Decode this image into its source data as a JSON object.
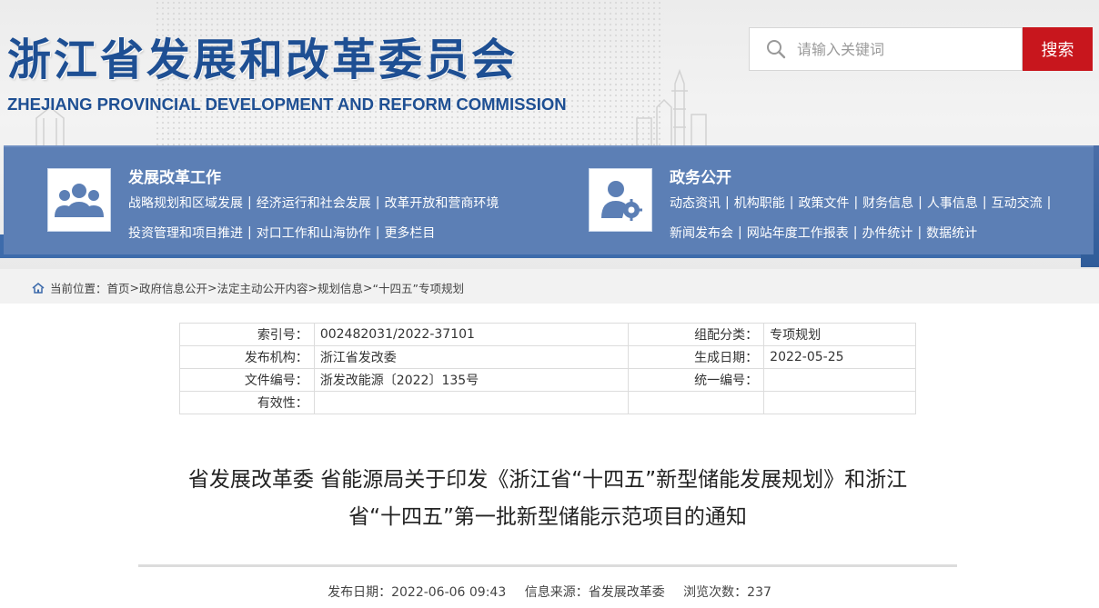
{
  "header": {
    "title_cn": "浙江省发展和改革委员会",
    "title_en": "ZHEJIANG PROVINCIAL DEVELOPMENT AND REFORM COMMISSION"
  },
  "search": {
    "placeholder": "请输入关键词",
    "button_label": "搜索"
  },
  "nav": {
    "left": {
      "heading": "发展改革工作",
      "icon": "people-group-icon",
      "row1": [
        "战略规划和区域发展",
        "经济运行和社会发展",
        "改革开放和营商环境"
      ],
      "row2": [
        "投资管理和项目推进",
        "对口工作和山海协作",
        "更多栏目"
      ]
    },
    "right": {
      "heading": "政务公开",
      "icon": "user-gear-icon",
      "row1": [
        "动态资讯",
        "机构职能",
        "政策文件",
        "财务信息",
        "人事信息",
        "互动交流"
      ],
      "row2": [
        "新闻发布会",
        "网站年度工作报表",
        "办件统计",
        "数据统计"
      ]
    },
    "separator": "|",
    "row1_trailing_sep": "|"
  },
  "breadcrumb": {
    "prefix": "当前位置：",
    "items": [
      "首页",
      "政府信息公开",
      "法定主动公开内容",
      "规划信息",
      "“十四五”专项规划"
    ],
    "separator": ">"
  },
  "meta": {
    "index_label": "索引号：",
    "index_value": "002482031/2022-37101",
    "category_label": "组配分类：",
    "category_value": "专项规划",
    "publisher_label": "发布机构：",
    "publisher_value": "浙江省发改委",
    "date_label": "生成日期：",
    "date_value": "2022-05-25",
    "docno_label": "文件编号：",
    "docno_value": "浙发改能源〔2022〕135号",
    "unified_label": "统一编号：",
    "unified_value": "",
    "validity_label": "有效性：",
    "validity_value": ""
  },
  "article": {
    "title_line1": "省发展改革委 省能源局关于印发《浙江省“十四五”新型储能发展规划》和浙江",
    "title_line2": "省“十四五”第一批新型储能示范项目的通知",
    "publish_date": "发布日期：2022-06-06 09:43",
    "source": "信息来源：省发展改革委",
    "views": "浏览次数：237"
  },
  "colors": {
    "brand_blue": "#1e4f93",
    "nav_blue": "#5c7fb5",
    "search_red": "#c8161d"
  }
}
